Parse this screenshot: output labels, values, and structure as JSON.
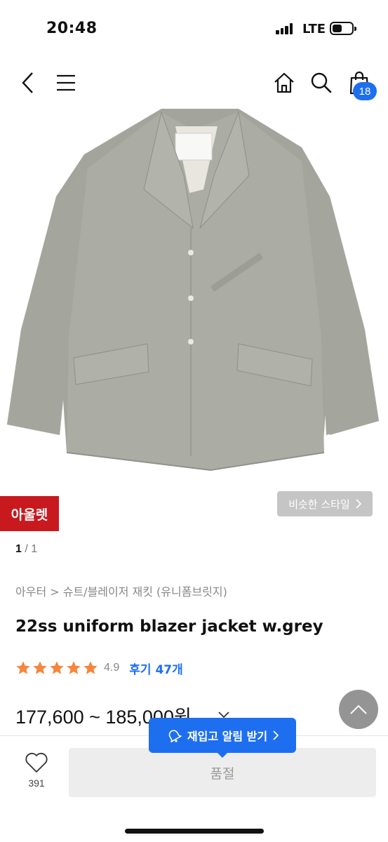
{
  "status_bar": {
    "time": "20:48",
    "network": "LTE"
  },
  "nav": {
    "back_icon": "chevron-left-icon",
    "menu_icon": "hamburger-icon",
    "home_icon": "home-icon",
    "search_icon": "search-icon",
    "cart_icon": "shopping-bag-icon",
    "cart_count": "18"
  },
  "product": {
    "outlet_badge": "아울렛",
    "similar_style_label": "비슷한 스타일",
    "pager_current": "1",
    "pager_total": " / 1",
    "breadcrumb": "아우터 > 슈트/블레이저 재킷 (유니폼브릿지)",
    "title": "22ss uniform blazer jacket w.grey",
    "rating": 4.9,
    "rating_label": "4.9",
    "review_label": "후기 47개",
    "price": "177,600 ~ 185,000원"
  },
  "bottom_bar": {
    "like_count": "391",
    "soldout_label": "품절",
    "restock_label": "재입고 알림 받기"
  },
  "colors": {
    "accent_blue": "#1e6ff0",
    "outlet_red": "#c8191f",
    "star_orange": "#f5863c"
  }
}
